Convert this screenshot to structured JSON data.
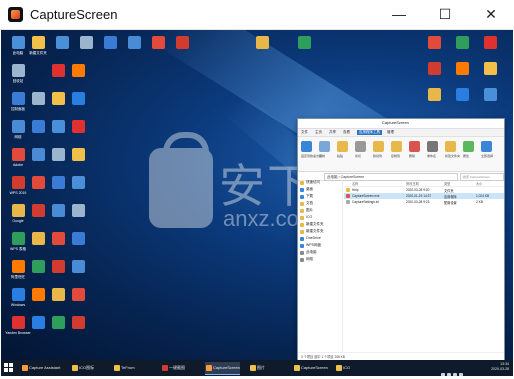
{
  "window": {
    "title": "CaptureScreen",
    "minimize": "—",
    "maximize": "☐",
    "close": "✕"
  },
  "desktop": {
    "icons": [
      {
        "label": "此电脑",
        "color": "#4a90d9"
      },
      {
        "label": "回收站",
        "color": "#9bb5cf"
      },
      {
        "label": "控制面板",
        "color": "#3a7bd5"
      },
      {
        "label": "网络",
        "color": "#4a8bd6"
      },
      {
        "label": "Adobe",
        "color": "#e24a3b"
      },
      {
        "label": "WPS 2019",
        "color": "#d23b2f"
      },
      {
        "label": "Google",
        "color": "#e8b74a"
      },
      {
        "label": "WPS 表格",
        "color": "#2f9e5c"
      },
      {
        "label": "阿里旺旺",
        "color": "#ff7a00"
      },
      {
        "label": "Windows",
        "color": "#2a7de1"
      },
      {
        "label": "Yandex Browser",
        "color": "#e03131"
      },
      {
        "label": "新建文件夹",
        "color": "#f0c04a"
      }
    ],
    "watermark_cn": "安下载",
    "watermark_en": "anxz.com"
  },
  "explorer": {
    "title": "CaptureScreen",
    "tabs": [
      "文件",
      "主页",
      "共享",
      "查看",
      "应用程序工具",
      "管理"
    ],
    "ribbon": [
      "固定到快速访问",
      "复制",
      "粘贴",
      "剪切",
      "移动到",
      "复制到",
      "删除",
      "重命名",
      "新建文件夹",
      "属性",
      "全部选择"
    ],
    "address": "此电脑 › CaptureScreen",
    "search_placeholder": "搜索 CaptureScreen",
    "nav": [
      {
        "label": "快速访问",
        "type": "star"
      },
      {
        "label": "桌面",
        "type": "blue"
      },
      {
        "label": "下载",
        "type": "blue"
      },
      {
        "label": "文档",
        "type": "folder"
      },
      {
        "label": "图片",
        "type": "folder"
      },
      {
        "label": "ICO",
        "type": "folder"
      },
      {
        "label": "新建文件夹",
        "type": "folder"
      },
      {
        "label": "新建文件夹",
        "type": "folder"
      },
      {
        "label": "OneDrive",
        "type": "blue"
      },
      {
        "label": "WPS网盘",
        "type": "blue"
      },
      {
        "label": "此电脑",
        "type": "gray"
      },
      {
        "label": "网络",
        "type": "gray"
      }
    ],
    "columns": [
      "名称",
      "修改日期",
      "类型",
      "大小"
    ],
    "files": [
      {
        "name": "Help",
        "date": "2020-03-28 9:20",
        "type": "文件夹",
        "size": "",
        "color": "#e8b84a",
        "selected": false
      },
      {
        "name": "CaptureScreen.exe",
        "date": "2020-01-19 14:37",
        "type": "应用程序",
        "size": "1,024 KB",
        "color": "#d9534f",
        "selected": true
      },
      {
        "name": "CaptureSettings.ini",
        "date": "2020-03-28 9:23",
        "type": "配置设置",
        "size": "2 KB",
        "color": "#aaaaaa",
        "selected": false
      }
    ],
    "status": "3 个项目    选中 1 个项目  258 KB"
  },
  "taskbar": {
    "items": [
      {
        "label": "Capture Assistant",
        "color": "#ff9a3c",
        "active": false
      },
      {
        "label": "ICO图标",
        "color": "#f0c04a",
        "active": false
      },
      {
        "label": "TeFrom",
        "color": "#f0c04a",
        "active": false
      },
      {
        "label": "一键截图",
        "color": "#d23b2f",
        "active": false
      },
      {
        "label": "CaptureScreen",
        "color": "#ff9a3c",
        "active": true
      },
      {
        "label": "图片",
        "color": "#f0c04a",
        "active": false
      },
      {
        "label": "CaptureScreen",
        "color": "#f0c04a",
        "active": false
      },
      {
        "label": "ICO",
        "color": "#f0c04a",
        "active": false
      }
    ],
    "time": "13:34",
    "date": "2020-03-28"
  }
}
